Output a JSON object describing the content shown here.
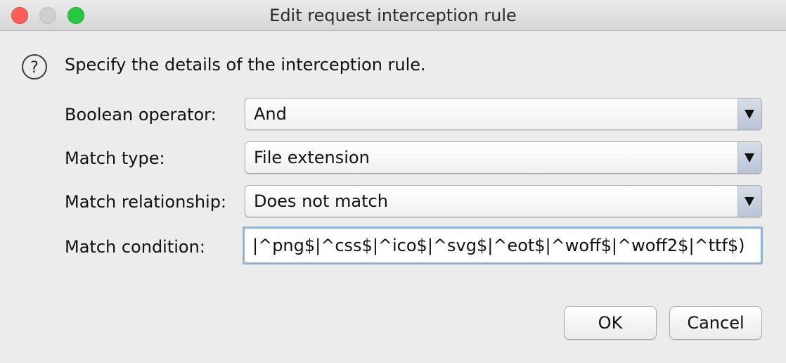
{
  "window": {
    "title": "Edit request interception rule"
  },
  "dialog": {
    "intro": "Specify the details of the interception rule.",
    "icon": "question-icon",
    "fields": {
      "boolean_operator": {
        "label": "Boolean operator:",
        "value": "And"
      },
      "match_type": {
        "label": "Match type:",
        "value": "File extension"
      },
      "match_relationship": {
        "label": "Match relationship:",
        "value": "Does not match"
      },
      "match_condition": {
        "label": "Match condition:",
        "value": "|^png$|^css$|^ico$|^svg$|^eot$|^woff$|^woff2$|^ttf$)"
      }
    }
  },
  "buttons": {
    "ok": "OK",
    "cancel": "Cancel"
  },
  "colors": {
    "close": "#fe5f57",
    "minimize": "#cfcfcf",
    "maximize": "#28c840",
    "focus_ring": "#8fb2d6"
  }
}
